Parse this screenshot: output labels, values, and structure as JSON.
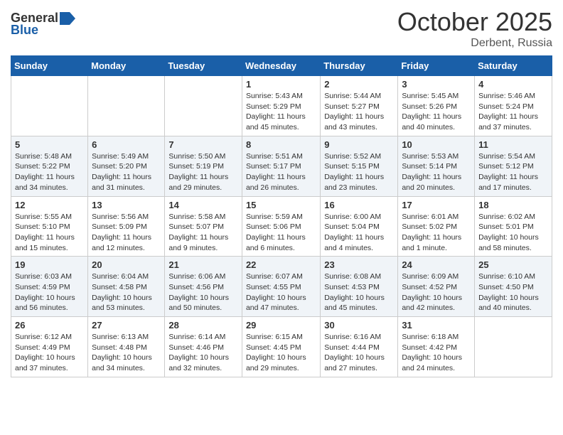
{
  "logo": {
    "general": "General",
    "blue": "Blue"
  },
  "title": "October 2025",
  "location": "Derbent, Russia",
  "days_of_week": [
    "Sunday",
    "Monday",
    "Tuesday",
    "Wednesday",
    "Thursday",
    "Friday",
    "Saturday"
  ],
  "weeks": [
    [
      {
        "day": "",
        "info": ""
      },
      {
        "day": "",
        "info": ""
      },
      {
        "day": "",
        "info": ""
      },
      {
        "day": "1",
        "info": "Sunrise: 5:43 AM\nSunset: 5:29 PM\nDaylight: 11 hours and 45 minutes."
      },
      {
        "day": "2",
        "info": "Sunrise: 5:44 AM\nSunset: 5:27 PM\nDaylight: 11 hours and 43 minutes."
      },
      {
        "day": "3",
        "info": "Sunrise: 5:45 AM\nSunset: 5:26 PM\nDaylight: 11 hours and 40 minutes."
      },
      {
        "day": "4",
        "info": "Sunrise: 5:46 AM\nSunset: 5:24 PM\nDaylight: 11 hours and 37 minutes."
      }
    ],
    [
      {
        "day": "5",
        "info": "Sunrise: 5:48 AM\nSunset: 5:22 PM\nDaylight: 11 hours and 34 minutes."
      },
      {
        "day": "6",
        "info": "Sunrise: 5:49 AM\nSunset: 5:20 PM\nDaylight: 11 hours and 31 minutes."
      },
      {
        "day": "7",
        "info": "Sunrise: 5:50 AM\nSunset: 5:19 PM\nDaylight: 11 hours and 29 minutes."
      },
      {
        "day": "8",
        "info": "Sunrise: 5:51 AM\nSunset: 5:17 PM\nDaylight: 11 hours and 26 minutes."
      },
      {
        "day": "9",
        "info": "Sunrise: 5:52 AM\nSunset: 5:15 PM\nDaylight: 11 hours and 23 minutes."
      },
      {
        "day": "10",
        "info": "Sunrise: 5:53 AM\nSunset: 5:14 PM\nDaylight: 11 hours and 20 minutes."
      },
      {
        "day": "11",
        "info": "Sunrise: 5:54 AM\nSunset: 5:12 PM\nDaylight: 11 hours and 17 minutes."
      }
    ],
    [
      {
        "day": "12",
        "info": "Sunrise: 5:55 AM\nSunset: 5:10 PM\nDaylight: 11 hours and 15 minutes."
      },
      {
        "day": "13",
        "info": "Sunrise: 5:56 AM\nSunset: 5:09 PM\nDaylight: 11 hours and 12 minutes."
      },
      {
        "day": "14",
        "info": "Sunrise: 5:58 AM\nSunset: 5:07 PM\nDaylight: 11 hours and 9 minutes."
      },
      {
        "day": "15",
        "info": "Sunrise: 5:59 AM\nSunset: 5:06 PM\nDaylight: 11 hours and 6 minutes."
      },
      {
        "day": "16",
        "info": "Sunrise: 6:00 AM\nSunset: 5:04 PM\nDaylight: 11 hours and 4 minutes."
      },
      {
        "day": "17",
        "info": "Sunrise: 6:01 AM\nSunset: 5:02 PM\nDaylight: 11 hours and 1 minute."
      },
      {
        "day": "18",
        "info": "Sunrise: 6:02 AM\nSunset: 5:01 PM\nDaylight: 10 hours and 58 minutes."
      }
    ],
    [
      {
        "day": "19",
        "info": "Sunrise: 6:03 AM\nSunset: 4:59 PM\nDaylight: 10 hours and 56 minutes."
      },
      {
        "day": "20",
        "info": "Sunrise: 6:04 AM\nSunset: 4:58 PM\nDaylight: 10 hours and 53 minutes."
      },
      {
        "day": "21",
        "info": "Sunrise: 6:06 AM\nSunset: 4:56 PM\nDaylight: 10 hours and 50 minutes."
      },
      {
        "day": "22",
        "info": "Sunrise: 6:07 AM\nSunset: 4:55 PM\nDaylight: 10 hours and 47 minutes."
      },
      {
        "day": "23",
        "info": "Sunrise: 6:08 AM\nSunset: 4:53 PM\nDaylight: 10 hours and 45 minutes."
      },
      {
        "day": "24",
        "info": "Sunrise: 6:09 AM\nSunset: 4:52 PM\nDaylight: 10 hours and 42 minutes."
      },
      {
        "day": "25",
        "info": "Sunrise: 6:10 AM\nSunset: 4:50 PM\nDaylight: 10 hours and 40 minutes."
      }
    ],
    [
      {
        "day": "26",
        "info": "Sunrise: 6:12 AM\nSunset: 4:49 PM\nDaylight: 10 hours and 37 minutes."
      },
      {
        "day": "27",
        "info": "Sunrise: 6:13 AM\nSunset: 4:48 PM\nDaylight: 10 hours and 34 minutes."
      },
      {
        "day": "28",
        "info": "Sunrise: 6:14 AM\nSunset: 4:46 PM\nDaylight: 10 hours and 32 minutes."
      },
      {
        "day": "29",
        "info": "Sunrise: 6:15 AM\nSunset: 4:45 PM\nDaylight: 10 hours and 29 minutes."
      },
      {
        "day": "30",
        "info": "Sunrise: 6:16 AM\nSunset: 4:44 PM\nDaylight: 10 hours and 27 minutes."
      },
      {
        "day": "31",
        "info": "Sunrise: 6:18 AM\nSunset: 4:42 PM\nDaylight: 10 hours and 24 minutes."
      },
      {
        "day": "",
        "info": ""
      }
    ]
  ]
}
